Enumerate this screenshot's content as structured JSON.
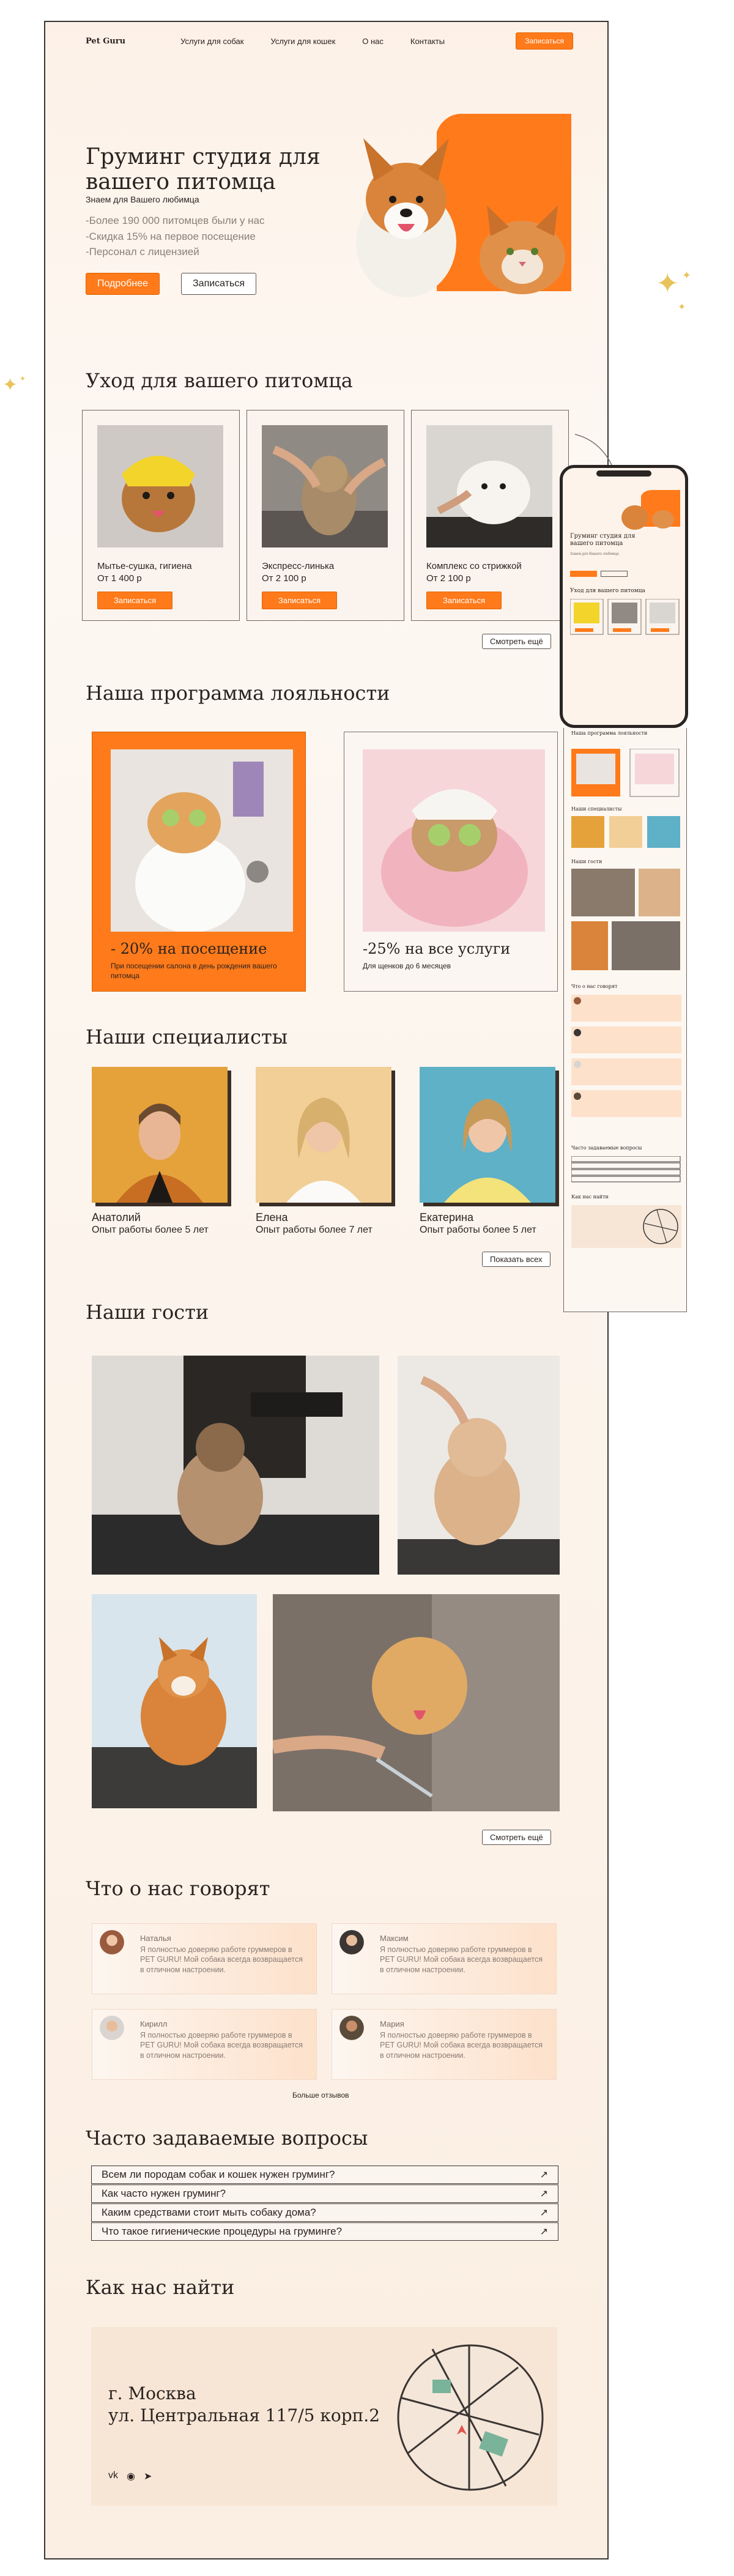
{
  "brand": {
    "accent": "#ff7a1a",
    "bg": "#fdf1e7",
    "ink": "#2a2320"
  },
  "nav": {
    "logo": "Pet Guru",
    "items": [
      "Услуги для собак",
      "Услуги для кошек",
      "О нас",
      "Контакты"
    ],
    "cta": "Записаться"
  },
  "hero": {
    "title": "Груминг студия для вашего питомца",
    "subtitle": "Знаем для Вашего любимца",
    "bullets": [
      "-Более 190 000 питомцев были у нас",
      "-Скидка 15% на первое посещение",
      "-Персонал с лицензией"
    ],
    "primary_btn": "Подробнее",
    "secondary_btn": "Записаться"
  },
  "care": {
    "title": "Уход для вашего питомца",
    "cards": [
      {
        "name": "Мытье-сушка, гигиена",
        "price": "От 1 400 р",
        "button": "Записаться"
      },
      {
        "name": "Экспресс-линька",
        "price": "От 2 100 р",
        "button": "Записаться"
      },
      {
        "name": "Комплекс со стрижкой",
        "price": "От 2 100 р",
        "button": "Записаться"
      }
    ],
    "more": "Смотреть ещё"
  },
  "loyalty": {
    "title": "Наша программа лояльности",
    "cards": [
      {
        "title": "- 20% на посещение",
        "text": "При посещении салона в день рождения вашего питомца"
      },
      {
        "title": "-25% на все услуги",
        "text": "Для щенков до 6 месяцев"
      }
    ]
  },
  "specialists": {
    "title": "Наши специалисты",
    "people": [
      {
        "name": "Анатолий",
        "exp": "Опыт работы более 5 лет"
      },
      {
        "name": "Елена",
        "exp": "Опыт работы более 7 лет"
      },
      {
        "name": "Екатерина",
        "exp": "Опыт работы более 5 лет"
      }
    ],
    "more": "Показать всех"
  },
  "guests": {
    "title": "Наши гости",
    "more": "Смотреть ещё"
  },
  "reviews": {
    "title": "Что о нас говорят",
    "items": [
      {
        "name": "Наталья",
        "text": "Я полностью доверяю работе груммеров в PET GURU! Мой собака всегда возвращается в отличном настроении."
      },
      {
        "name": "Максим",
        "text": "Я полностью доверяю работе груммеров в PET GURU! Мой собака всегда возвращается в отличном настроении."
      },
      {
        "name": "Кирилл",
        "text": "Я полностью доверяю работе груммеров в PET GURU! Мой собака всегда возвращается в отличном настроении."
      },
      {
        "name": "Мария",
        "text": "Я полностью доверяю работе груммеров в PET GURU! Мой собака всегда возвращается в отличном настроении."
      }
    ],
    "more": "Больше отзывов"
  },
  "faq": {
    "title": "Часто задаваемые вопросы",
    "items": [
      "Всем ли породам собак и кошек нужен груминг?",
      "Как часто нужен груминг?",
      "Каким средствами стоит мыть собаку дома?",
      "Что такое гигиенические процедуры на груминге?"
    ]
  },
  "contacts": {
    "title": "Как нас найти",
    "city": "г. Москва",
    "address": "ул. Центральная 117/5 корп.2",
    "socials": [
      "vk-icon",
      "whatsapp-icon",
      "telegram-icon"
    ]
  },
  "mobile": {
    "title": "Груминг студия для вашего питомца",
    "care_title": "Уход для вашего питомца",
    "loyalty_title": "Наша программа лояльности",
    "spec_title": "Наши специалисты",
    "guests_title": "Наши гости",
    "reviews_title": "Что о нас говорят",
    "faq_title": "Часто задаваемые вопросы",
    "contacts_title": "Как нас найти"
  }
}
